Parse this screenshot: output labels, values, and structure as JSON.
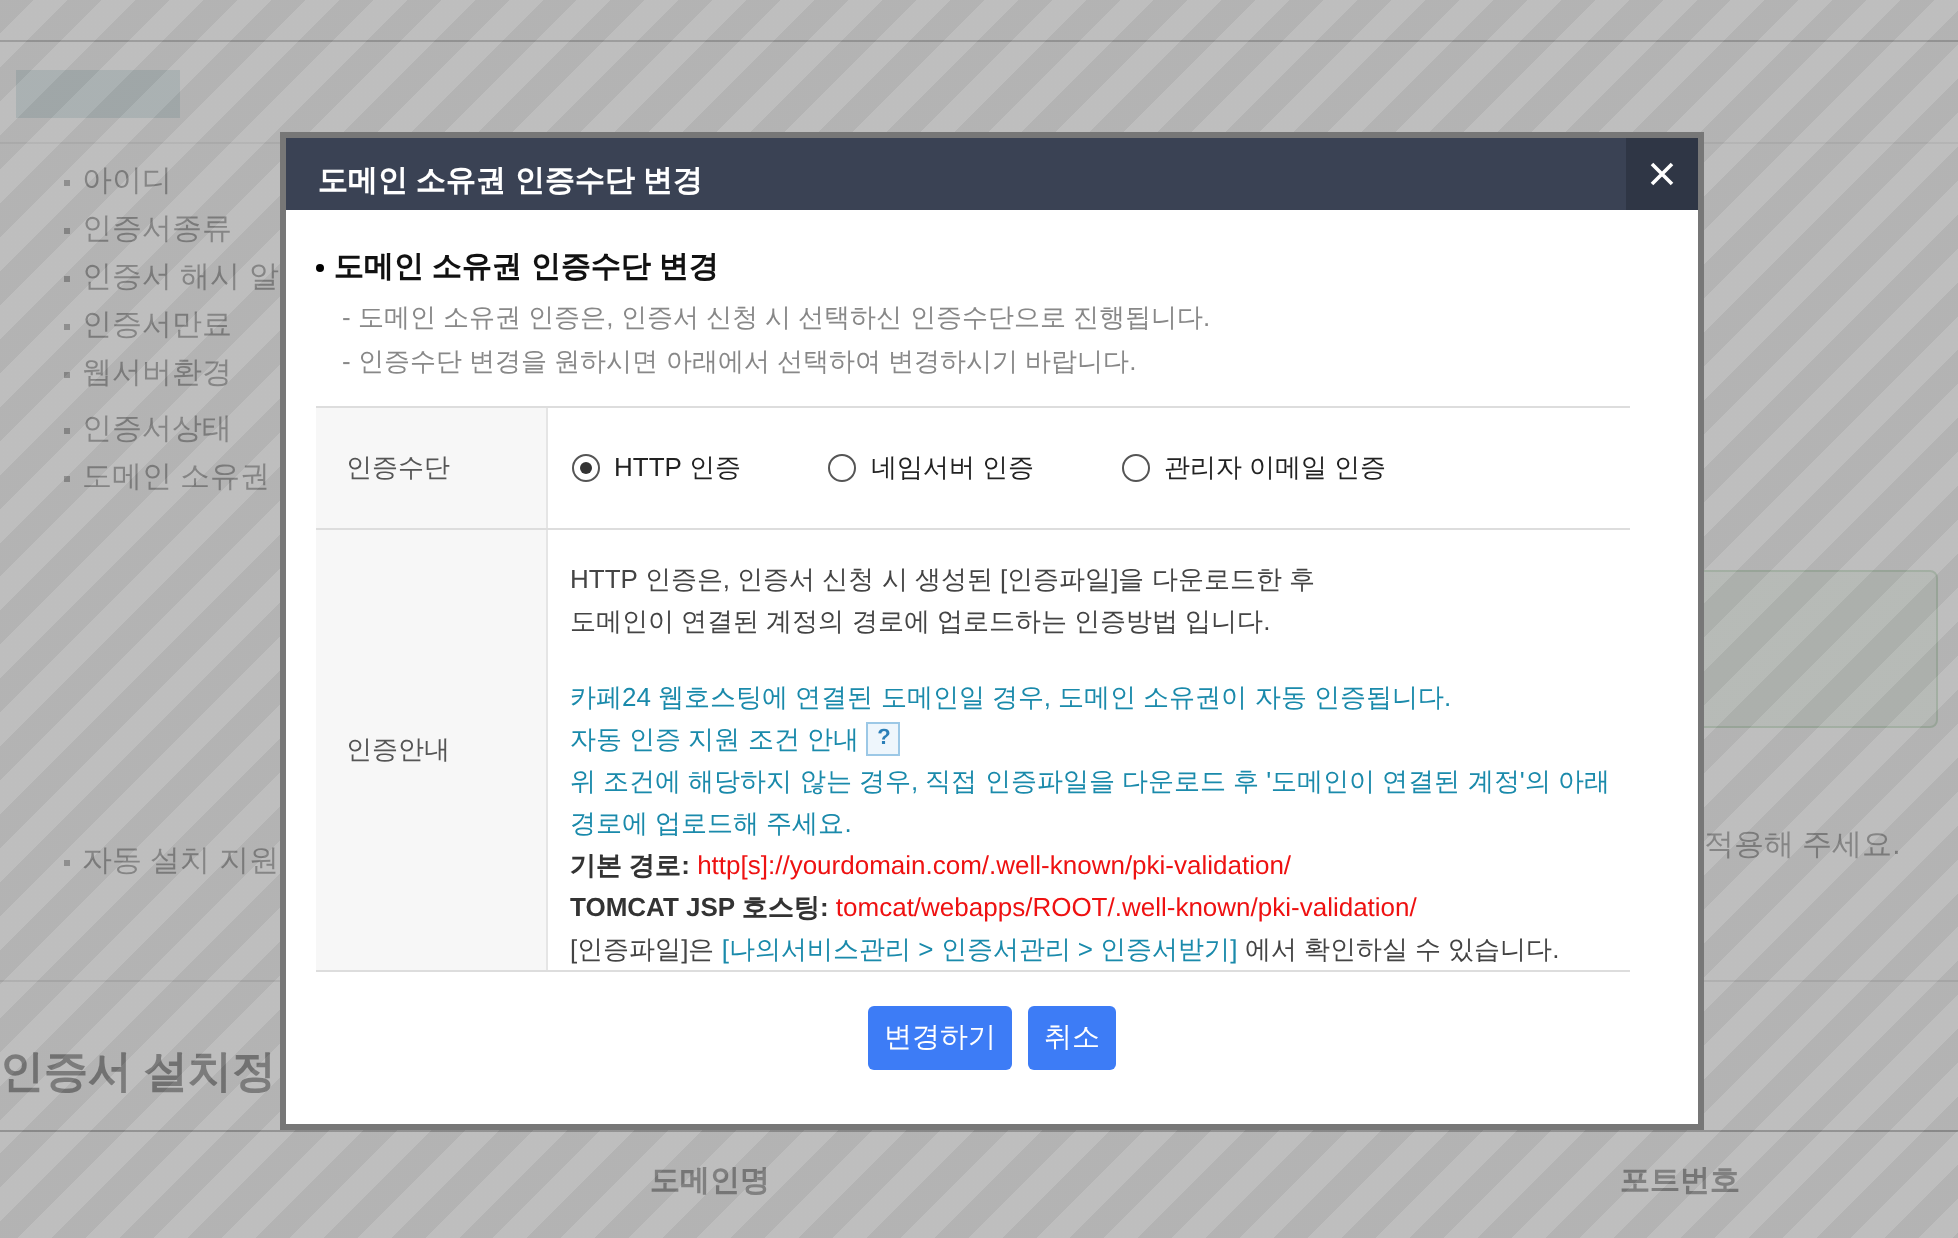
{
  "page": {
    "field_groups": [
      [
        "아이디",
        "인증서종류",
        "인증서 해시 알",
        "인증서만료",
        "웹서버환경"
      ],
      [
        "인증서상태",
        "도메인 소유권"
      ],
      [
        "자동 설치 지원"
      ]
    ],
    "note": "적용해 주세요.",
    "section_title": "인증서 설치정",
    "columns": [
      "도메인명",
      "포트번호"
    ]
  },
  "dialog": {
    "title": "도메인 소유권 인증수단 변경",
    "heading": "도메인 소유권 인증수단 변경",
    "notes": [
      "- 도메인 소유권 인증은, 인증서 신청 시 선택하신 인증수단으로 진행됩니다.",
      "- 인증수단 변경을 원하시면 아래에서 선택하여 변경하시기 바랍니다."
    ],
    "method_label": "인증수단",
    "methods": [
      {
        "label": "HTTP 인증",
        "selected": true
      },
      {
        "label": "네임서버 인증",
        "selected": false
      },
      {
        "label": "관리자 이메일 인증",
        "selected": false
      }
    ],
    "guide_label": "인증안내",
    "guide": [
      {
        "kind": "plain",
        "text": "HTTP 인증은, 인증서 신청 시 생성된 [인증파일]을 다운로드한 후"
      },
      {
        "kind": "plain",
        "text": "도메인이 연결된 계정의 경로에 업로드하는 인증방법 입니다."
      },
      {
        "kind": "blank"
      },
      {
        "kind": "info",
        "text": "카페24 웹호스팅에 연결된 도메인일 경우, 도메인 소유권이 자동 인증됩니다."
      },
      {
        "kind": "help",
        "text": "자동 인증 지원 조건 안내",
        "badge": "?"
      },
      {
        "kind": "info",
        "text": "위 조건에 해당하지 않는 경우, 직접 인증파일을 다운로드 후 '도메인이 연결된 계정'의 아래 경로에 업로드해 주세요."
      },
      {
        "kind": "path",
        "label": "기본 경로:",
        "value": "http[s]://yourdomain.com/.well-known/pki-validation/"
      },
      {
        "kind": "path",
        "label": "TOMCAT JSP 호스팅:",
        "value": "tomcat/webapps/ROOT/.well-known/pki-validation/"
      },
      {
        "kind": "menu",
        "text": "[인증파일]은",
        "link": "[나의서비스관리 > 인증서관리 > 인증서받기]",
        "suffix": "에서 확인하실 수 있습니다."
      }
    ],
    "buttons": [
      "변경하기",
      "취소"
    ]
  }
}
